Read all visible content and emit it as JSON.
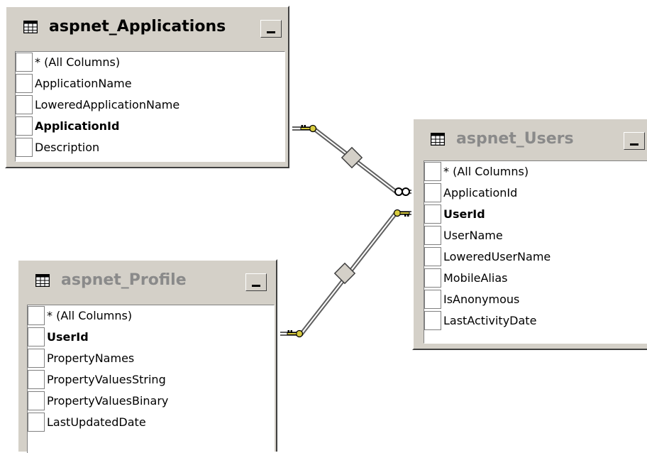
{
  "tables": {
    "applications": {
      "name": "aspnet_Applications",
      "columns": [
        "* (All Columns)",
        "ApplicationName",
        "LoweredApplicationName",
        "ApplicationId",
        "Description"
      ]
    },
    "users": {
      "name": "aspnet_Users",
      "columns": [
        "* (All Columns)",
        "ApplicationId",
        "UserId",
        "UserName",
        "LoweredUserName",
        "MobileAlias",
        "IsAnonymous",
        "LastActivityDate"
      ]
    },
    "profile": {
      "name": "aspnet_Profile",
      "columns": [
        "* (All Columns)",
        "UserId",
        "PropertyNames",
        "PropertyValuesString",
        "PropertyValuesBinary",
        "LastUpdatedDate"
      ]
    }
  },
  "relationships": [
    {
      "from": "aspnet_Applications.ApplicationId",
      "to": "aspnet_Users.ApplicationId",
      "one_end": "key",
      "many_end": "infinity"
    },
    {
      "from": "aspnet_Users.UserId",
      "to": "aspnet_Profile.UserId",
      "one_end": "key",
      "many_end": "key"
    }
  ],
  "colors": {
    "window_face": "#d4d0c8",
    "inactive_title": "#8a8a8a",
    "key_icon": "#d8cc40"
  },
  "icons": {
    "table": "table-grid-icon",
    "minimize": "minimize-icon",
    "key": "key-icon",
    "many": "infinity-icon"
  }
}
